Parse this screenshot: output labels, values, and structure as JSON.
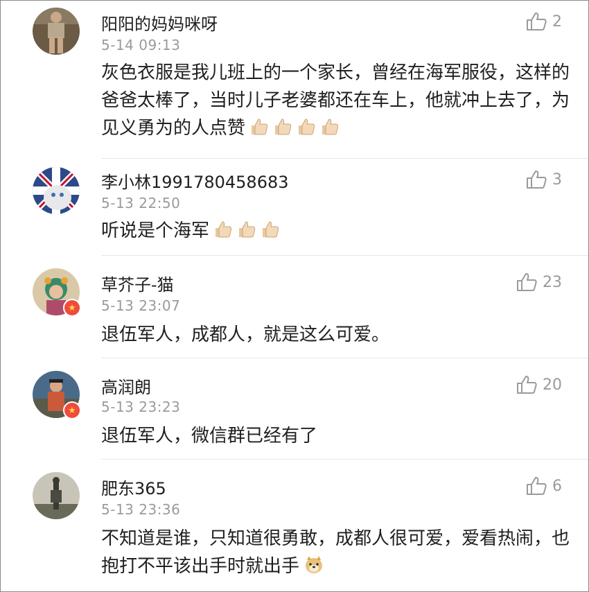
{
  "comments": [
    {
      "user": "阳阳的妈妈咪呀",
      "time": "5-14 09:13",
      "likes": "2",
      "text": "灰色衣服是我儿班上的一个家长，曾经在海军服役，这样的爸爸太棒了，当时儿子老婆都还在车上，他就冲上去了，为见义勇为的人点赞",
      "emoji": "thumbs-up-icon",
      "emoji_count": 4,
      "verified": false
    },
    {
      "user": "李小林1991780458683",
      "time": "5-13 22:50",
      "likes": "3",
      "text": "听说是个海军",
      "emoji": "thumbs-up-icon",
      "emoji_count": 3,
      "verified": false
    },
    {
      "user": "草芥子-猫",
      "time": "5-13 23:07",
      "likes": "23",
      "text": "退伍军人，成都人，就是这么可爱。",
      "verified": true
    },
    {
      "user": "高润朗",
      "time": "5-13 23:23",
      "likes": "20",
      "text": "退伍军人，微信群已经有了",
      "verified": true
    },
    {
      "user": "肥东365",
      "time": "5-13 23:36",
      "likes": "6",
      "text": "不知道是谁，只知道很勇敢，成都人很可爱，爱看热闹，也抱打不平该出手时就出手",
      "emoji": "doge-icon",
      "emoji_count": 1,
      "verified": false
    }
  ],
  "colors": {
    "like_gray": "#9a9a9a",
    "time_gray": "#9a9a9a",
    "badge_red": "#f04b3c",
    "divider": "#e6e6e6"
  }
}
